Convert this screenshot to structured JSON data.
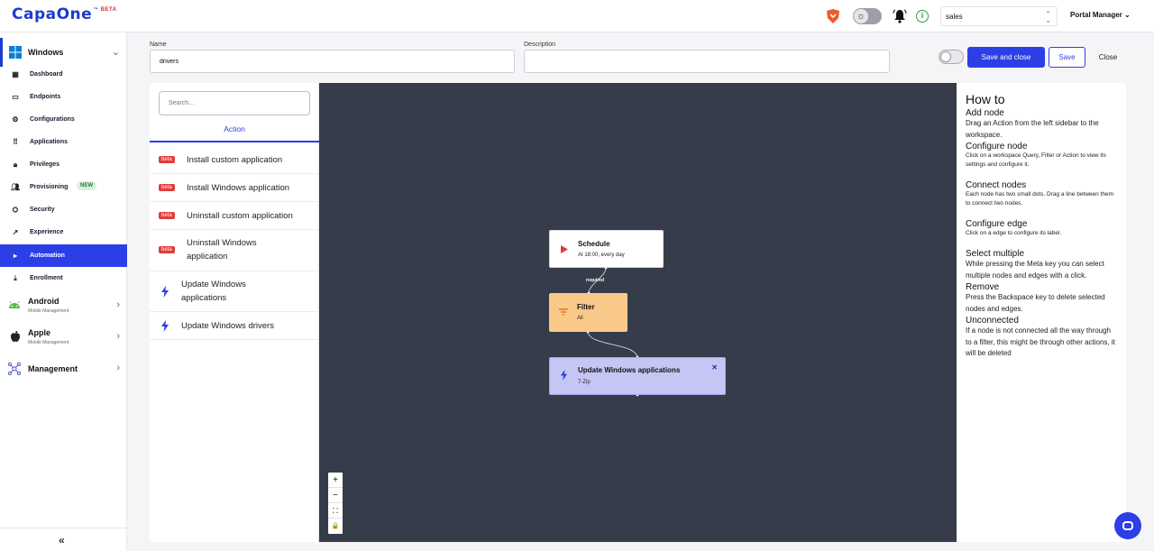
{
  "app": {
    "logo": "CapaOne",
    "logo_tm": "™",
    "logo_beta": "BETA",
    "tenant": "sales",
    "portal_manager": "Portal Manager ⌄"
  },
  "sidebar": {
    "windows_group": {
      "label": "Windows",
      "icon": "windows-icon"
    },
    "items": [
      {
        "label": "Dashboard",
        "icon": "dashboard-icon"
      },
      {
        "label": "Endpoints",
        "icon": "laptop-icon"
      },
      {
        "label": "Configurations",
        "icon": "gear-icon"
      },
      {
        "label": "Applications",
        "icon": "apps-grid-icon"
      },
      {
        "label": "Privileges",
        "icon": "lock-icon"
      },
      {
        "label": "Provisioning",
        "icon": "people-icon",
        "badge": "NEW"
      },
      {
        "label": "Security",
        "icon": "shield-gear-icon"
      },
      {
        "label": "Experience",
        "icon": "trend-icon"
      },
      {
        "label": "Automation",
        "icon": "play-icon",
        "active": true
      },
      {
        "label": "Enrollment",
        "icon": "download-icon"
      }
    ],
    "android": {
      "label": "Android",
      "sub": "Mobile Management"
    },
    "apple": {
      "label": "Apple",
      "sub": "Mobile Management"
    },
    "management": {
      "label": "Management"
    },
    "collapse": "«"
  },
  "form": {
    "name_label": "Name",
    "name_value": "drivers",
    "description_label": "Description",
    "description_value": "",
    "save_and_close": "Save and close",
    "save": "Save",
    "close": "Close"
  },
  "actions_panel": {
    "search_placeholder": "Search...",
    "tab": "Action",
    "items": [
      {
        "badge": "beta",
        "label": "Install custom application"
      },
      {
        "badge": "beta",
        "label": "Install Windows application"
      },
      {
        "badge": "beta",
        "label": "Uninstall custom application"
      },
      {
        "badge": "beta",
        "label": "Uninstall Windows application"
      },
      {
        "badge": "",
        "label": "Update Windows applications"
      },
      {
        "badge": "",
        "label": "Update Windows drivers"
      }
    ]
  },
  "canvas": {
    "nodes": [
      {
        "title": "Schedule",
        "subtitle": "At 18:00, every day",
        "icon": "play-icon"
      },
      {
        "title": "Filter",
        "subtitle": "All",
        "icon": "filter-icon"
      },
      {
        "title": "Update Windows applications",
        "subtitle": "7-Zip",
        "icon": "bolt-icon"
      }
    ],
    "edge_label": "required",
    "zoom_controls": [
      "+",
      "−",
      "⛶",
      "🔒"
    ]
  },
  "howto": {
    "title": "How to",
    "sections": [
      {
        "heading": "Add node",
        "text": "Drag an Action from the left sidebar to the workspace."
      },
      {
        "heading": "Configure node",
        "text": "Click on a workspace Query, Filter or Action to view its settings and configure it."
      },
      {
        "heading": "Connect nodes",
        "text": "Each node has two small dots. Drag a line between them to connect two nodes."
      },
      {
        "heading": "Configure edge",
        "text": "Click on a edge to configure its label."
      },
      {
        "heading": "Select multiple",
        "text": "While pressing the Meta key you can select multiple nodes and edges with a click."
      },
      {
        "heading": "Remove",
        "text": "Press the Backspace key to delete selected nodes and edges."
      },
      {
        "heading": "Unconnected",
        "text": "If a node is not connected all the way through to a filter, this might be through other actions, it will be deleted"
      }
    ]
  },
  "colors": {
    "brand": "#1d3bd1",
    "accent": "#2c3ee6",
    "canvas_bg": "#363c4a",
    "beta_red": "#e23b3b",
    "filter_node": "#f9c98a",
    "action_node": "#c6c6f5"
  }
}
